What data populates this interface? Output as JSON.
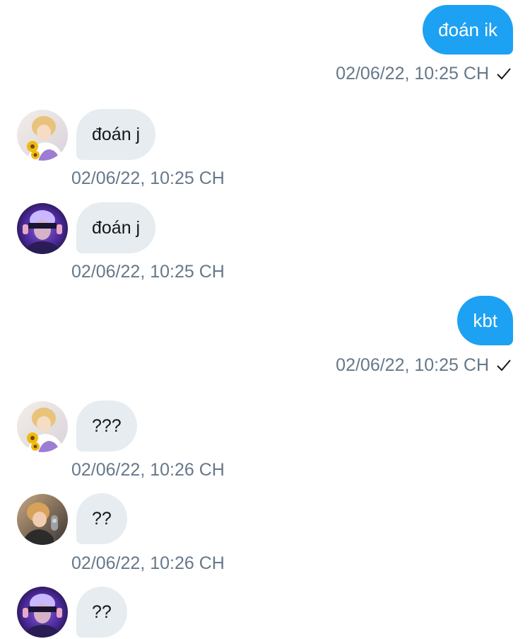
{
  "messages": [
    {
      "direction": "out",
      "text": "đoán ik",
      "time": "02/06/22, 10:25 CH",
      "status_icon": "checkmark-icon"
    },
    {
      "direction": "in",
      "avatar": "avatar-sunflower-blonde",
      "text": "đoán j",
      "time": "02/06/22, 10:25 CH"
    },
    {
      "direction": "in",
      "avatar": "avatar-purple-blindfold",
      "text": "đoán j",
      "time": "02/06/22, 10:25 CH"
    },
    {
      "direction": "out",
      "text": "kbt",
      "time": "02/06/22, 10:25 CH",
      "status_icon": "checkmark-icon"
    },
    {
      "direction": "in",
      "avatar": "avatar-sunflower-blonde",
      "text": "???",
      "time": "02/06/22, 10:26 CH"
    },
    {
      "direction": "in",
      "avatar": "avatar-studio-microphone",
      "text": "??",
      "time": "02/06/22, 10:26 CH"
    },
    {
      "direction": "in",
      "avatar": "avatar-purple-blindfold",
      "text": "??",
      "time": ""
    }
  ],
  "colors": {
    "outgoing_bubble": "#1da1f2",
    "incoming_bubble": "#e6ecf0",
    "timestamp": "#66788a"
  }
}
